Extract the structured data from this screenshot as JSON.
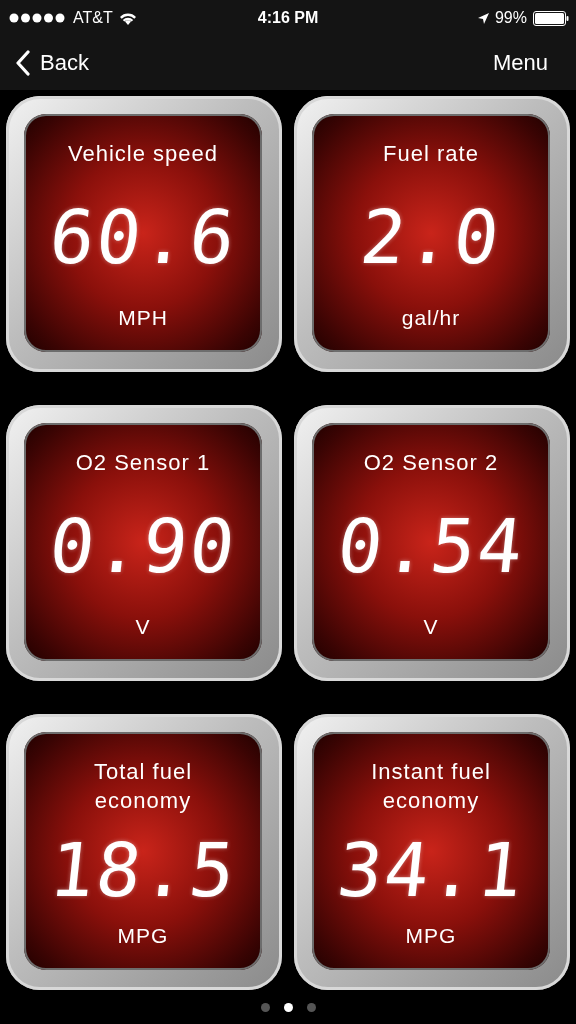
{
  "status_bar": {
    "carrier": "AT&T",
    "time": "4:16 PM",
    "battery": "99%"
  },
  "nav": {
    "back": "Back",
    "menu": "Menu"
  },
  "gauges": [
    {
      "label": "Vehicle speed",
      "value": "60.6",
      "unit": "MPH"
    },
    {
      "label": "Fuel rate",
      "value": "2.0",
      "unit": "gal/hr"
    },
    {
      "label": "O2 Sensor 1",
      "value": "0.90",
      "unit": "V"
    },
    {
      "label": "O2 Sensor 2",
      "value": "0.54",
      "unit": "V"
    },
    {
      "label": "Total fuel economy",
      "value": "18.5",
      "unit": "MPG"
    },
    {
      "label": "Instant fuel economy",
      "value": "34.1",
      "unit": "MPG"
    }
  ],
  "pages": [
    {
      "selected": false
    },
    {
      "selected": true
    },
    {
      "selected": false
    }
  ]
}
